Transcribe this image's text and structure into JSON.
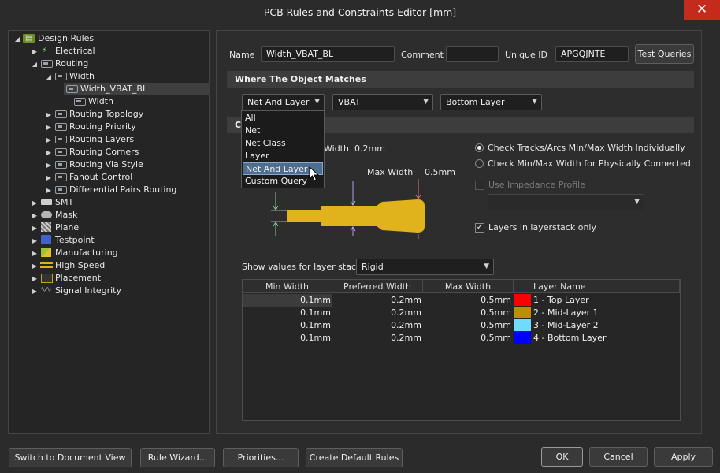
{
  "window": {
    "title": "PCB Rules and Constraints Editor [mm]",
    "close_glyph": "✕"
  },
  "tree": {
    "root": "Design Rules",
    "electrical": "Electrical",
    "routing": "Routing",
    "width": "Width",
    "width_vbat_bl": "Width_VBAT_BL",
    "width_rule": "Width",
    "routing_topology": "Routing Topology",
    "routing_priority": "Routing Priority",
    "routing_layers": "Routing Layers",
    "routing_corners": "Routing Corners",
    "routing_via_style": "Routing Via Style",
    "fanout_control": "Fanout Control",
    "diff_pairs": "Differential Pairs Routing",
    "smt": "SMT",
    "mask": "Mask",
    "plane": "Plane",
    "testpoint": "Testpoint",
    "manufacturing": "Manufacturing",
    "high_speed": "High Speed",
    "placement": "Placement",
    "signal_integrity": "Signal Integrity"
  },
  "header": {
    "name_label": "Name",
    "name_value": "Width_VBAT_BL",
    "comment_label": "Comment",
    "comment_value": "",
    "uid_label": "Unique ID",
    "uid_value": "APGQJNTE",
    "test_queries": "Test Queries"
  },
  "where": {
    "section_title": "Where The Object Matches",
    "type_value": "Net And Layer",
    "net_value": "VBAT",
    "layer_value": "Bottom Layer",
    "dropdown_options": [
      "All",
      "Net",
      "Net Class",
      "Layer",
      "Net And Layer",
      "Custom Query"
    ]
  },
  "constraints": {
    "section_title": "Co",
    "min_width_label": "Width",
    "min_width_value": "0.2mm",
    "max_width_label": "Max Width",
    "max_width_value": "0.5mm",
    "radio1": "Check Tracks/Arcs Min/Max Width Individually",
    "radio2": "Check Min/Max Width for Physically Connected",
    "impedance_label": "Use Impedance Profile",
    "layers_only_label": "Layers in layerstack only",
    "show_values_label": "Show values for layer stack",
    "stack_value": "Rigid"
  },
  "grid": {
    "headers": [
      "Min Width",
      "Preferred Width",
      "Max Width",
      "Layer Name"
    ],
    "rows": [
      {
        "min": "0.1mm",
        "pref": "0.2mm",
        "max": "0.5mm",
        "layer": "1 - Top Layer",
        "color": "#ff0000"
      },
      {
        "min": "0.1mm",
        "pref": "0.2mm",
        "max": "0.5mm",
        "layer": "2 - Mid-Layer 1",
        "color": "#bc8e00"
      },
      {
        "min": "0.1mm",
        "pref": "0.2mm",
        "max": "0.5mm",
        "layer": "3 - Mid-Layer 2",
        "color": "#70dbff"
      },
      {
        "min": "0.1mm",
        "pref": "0.2mm",
        "max": "0.5mm",
        "layer": "4 - Bottom Layer",
        "color": "#0000ff"
      }
    ]
  },
  "footer": {
    "switch_view": "Switch to Document View",
    "rule_wizard": "Rule Wizard...",
    "priorities": "Priorities...",
    "create_defaults": "Create Default Rules",
    "ok": "OK",
    "cancel": "Cancel",
    "apply": "Apply"
  }
}
